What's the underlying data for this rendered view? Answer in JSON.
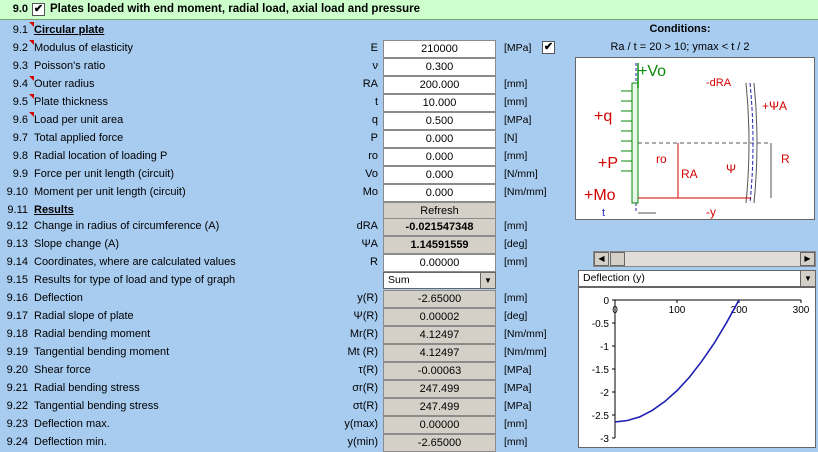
{
  "header": {
    "num": "9.0",
    "checkbox": "✔",
    "title": "Plates loaded with end moment, radial load, axial load and pressure"
  },
  "rows": [
    {
      "num": "9.1",
      "label": "Circular plate",
      "section": true,
      "tri": true
    },
    {
      "num": "9.2",
      "label": "Modulus of elasticity",
      "sym": "E",
      "val": "210000",
      "unit": "[MPa]",
      "tri": true,
      "chk": "✔"
    },
    {
      "num": "9.3",
      "label": "Poisson's ratio",
      "sym": "ν",
      "val": "0.300",
      "unit": ""
    },
    {
      "num": "9.4",
      "label": "Outer radius",
      "sym": "RA",
      "val": "200.000",
      "unit": "[mm]",
      "tri": true
    },
    {
      "num": "9.5",
      "label": "Plate thickness",
      "sym": "t",
      "val": "10.000",
      "unit": "[mm]",
      "tri": true
    },
    {
      "num": "9.6",
      "label": "Load per unit area",
      "sym": "q",
      "val": "0.500",
      "unit": "[MPa]",
      "tri": true
    },
    {
      "num": "9.7",
      "label": "Total applied force",
      "sym": "P",
      "val": "0.000",
      "unit": "[N]"
    },
    {
      "num": "9.8",
      "label": "Radial location of loading P",
      "sym": "ro",
      "val": "0.000",
      "unit": "[mm]"
    },
    {
      "num": "9.9",
      "label": "Force per unit length (circuit)",
      "sym": "Vo",
      "val": "0.000",
      "unit": "[N/mm]"
    },
    {
      "num": "9.10",
      "label": "Moment per unit length (circuit)",
      "sym": "Mo",
      "val": "0.000",
      "unit": "[Nm/mm]"
    },
    {
      "num": "9.11",
      "label": "Results",
      "section": true,
      "button": "Refresh"
    },
    {
      "num": "9.12",
      "label": "Change in radius of circumference (A)",
      "sym": "dRA",
      "val": "-0.021547348",
      "unit": "[mm]",
      "dark": true,
      "bold": true
    },
    {
      "num": "9.13",
      "label": "Slope change (A)",
      "sym": "ΨA",
      "val": "1.14591559",
      "unit": "[deg]",
      "dark": true,
      "bold": true
    },
    {
      "num": "9.14",
      "label": "Coordinates, where are calculated values",
      "sym": "R",
      "val": "0.00000",
      "unit": "[mm]"
    },
    {
      "num": "9.15",
      "label": "Results for type of load and type of graph",
      "select": "Sum"
    },
    {
      "num": "9.16",
      "label": "Deflection",
      "sym": "y(R)",
      "val": "-2.65000",
      "unit": "[mm]",
      "dark": true
    },
    {
      "num": "9.17",
      "label": "Radial slope of plate",
      "sym": "Ψ(R)",
      "val": "0.00002",
      "unit": "[deg]",
      "dark": true
    },
    {
      "num": "9.18",
      "label": "Radial bending moment",
      "sym": "Mr(R)",
      "val": "4.12497",
      "unit": "[Nm/mm]",
      "dark": true
    },
    {
      "num": "9.19",
      "label": "Tangential bending moment",
      "sym": "Mt (R)",
      "val": "4.12497",
      "unit": "[Nm/mm]",
      "dark": true
    },
    {
      "num": "9.20",
      "label": "Shear force",
      "sym": "τ(R)",
      "val": "-0.00063",
      "unit": "[MPa]",
      "dark": true
    },
    {
      "num": "9.21",
      "label": "Radial bending stress",
      "sym": "σr(R)",
      "val": "247.499",
      "unit": "[MPa]",
      "dark": true
    },
    {
      "num": "9.22",
      "label": "Tangential bending stress",
      "sym": "σt(R)",
      "val": "247.499",
      "unit": "[MPa]",
      "dark": true
    },
    {
      "num": "9.23",
      "label": "Deflection max.",
      "sym": "y(max)",
      "val": "0.00000",
      "unit": "[mm]",
      "dark": true
    },
    {
      "num": "9.24",
      "label": "Deflection min.",
      "sym": "y(min)",
      "val": "-2.65000",
      "unit": "[mm]",
      "dark": true
    }
  ],
  "conditions": {
    "title": "Conditions:",
    "text": "Ra / t = 20 > 10;  ymax < t / 2"
  },
  "diagram": {
    "labels": [
      "+Vo",
      "-dRA",
      "+q",
      "+ΨA",
      "ro",
      "+P",
      "RA",
      "Ψ",
      "R",
      "+Mo",
      "t",
      "-y"
    ]
  },
  "graph": {
    "selector": "Deflection (y)"
  },
  "chart_data": {
    "type": "line",
    "x": [
      0,
      20,
      40,
      60,
      80,
      100,
      120,
      140,
      160,
      180,
      200
    ],
    "series": [
      {
        "values": [
          -2.65,
          -2.62,
          -2.54,
          -2.4,
          -2.21,
          -1.97,
          -1.68,
          -1.33,
          -0.94,
          -0.49,
          0
        ]
      }
    ],
    "xticks": [
      "0",
      "100",
      "200",
      "300"
    ],
    "yticks": [
      "0",
      "-0.5",
      "-1",
      "-1.5",
      "-2",
      "-2.5",
      "-3"
    ],
    "xlim": [
      0,
      300
    ],
    "ylim": [
      -3,
      0
    ],
    "grid": false,
    "color": "#1f1fb4"
  }
}
